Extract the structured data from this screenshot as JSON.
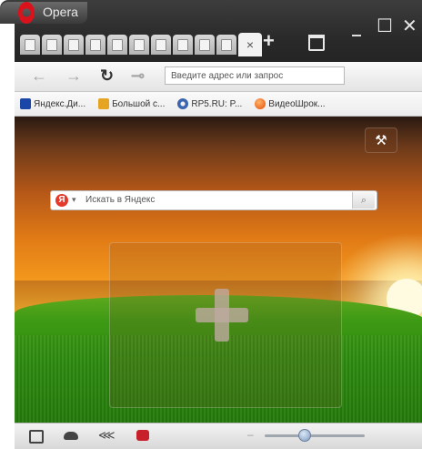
{
  "app": {
    "title": "Opera",
    "window_controls": {
      "minimize": "_",
      "maximize": "☐",
      "close": "✕"
    }
  },
  "tabs": {
    "count_mini": 10,
    "active_close": "×",
    "new_tab": "+",
    "trash_icon": "trash-icon"
  },
  "nav": {
    "back": "←",
    "forward": "→",
    "reload": "↻",
    "key_icon": "⊸",
    "address_placeholder": "Введите адрес или запрос"
  },
  "bookmarks": [
    {
      "label": "Яндекс.Ди...",
      "icon": "yandex-disk-icon"
    },
    {
      "label": "Большой с...",
      "icon": "bolshoy-icon"
    },
    {
      "label": "RP5.RU: P...",
      "icon": "rp5-icon"
    },
    {
      "label": "ВидеоШрок...",
      "icon": "video-icon"
    }
  ],
  "speed_dial": {
    "search_placeholder": "Искать в Яндекс",
    "search_engine_letter": "Я",
    "search_dropdown": "▾",
    "search_button": "⌕",
    "settings_icon": "wrench-icon",
    "add_icon": "plus-icon"
  },
  "statusbar": {
    "icons": [
      "panel-icon",
      "turbo-icon",
      "unite-icon",
      "opera-dragon-icon"
    ],
    "zoom_minus": "–",
    "zoom_percent": 40
  },
  "colors": {
    "accent": "#d9121b",
    "titlebar": "#2e2e2e"
  }
}
